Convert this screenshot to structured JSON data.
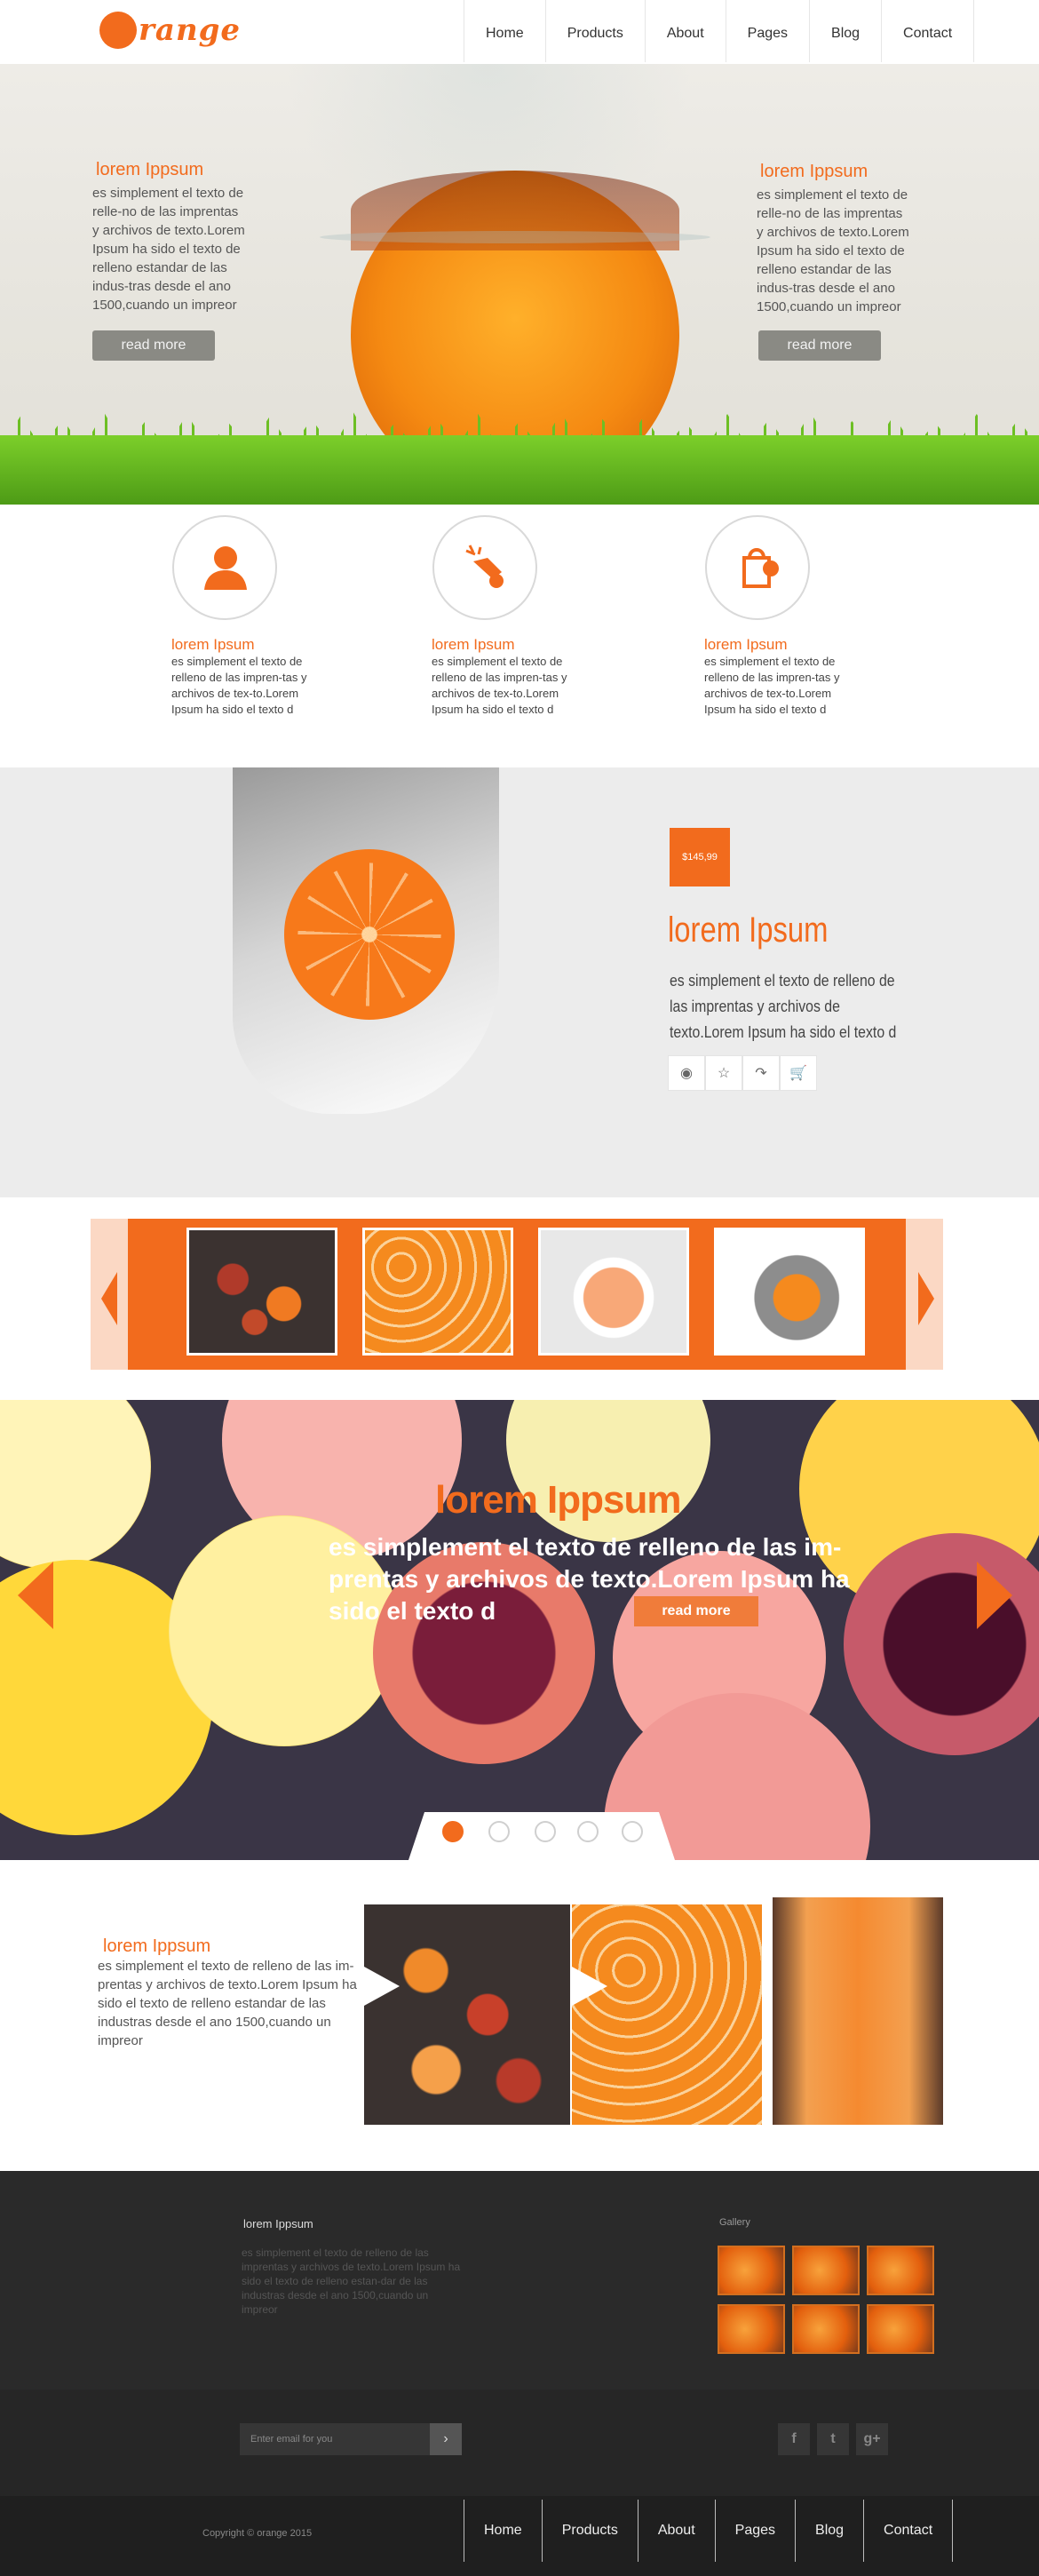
{
  "header": {
    "logo_text": "range",
    "nav": [
      "Home",
      "Products",
      "About",
      "Pages",
      "Blog",
      "Contact"
    ]
  },
  "hero": {
    "left": {
      "title": "lorem Ippsum",
      "text": "es simplement el texto de relle-no de las imprentas y archivos de texto.Lorem Ipsum ha sido el texto de relleno estandar de las indus-tras desde el ano 1500,cuando un impreor",
      "button": "read more"
    },
    "right": {
      "title": "lorem Ippsum",
      "text": "es simplement el texto de relle-no de las imprentas y archivos de texto.Lorem Ipsum ha sido el texto de relleno estandar de las indus-tras desde el ano 1500,cuando un impreor",
      "button": "read more"
    }
  },
  "features": [
    {
      "icon": "person-icon",
      "title": "lorem Ipsum",
      "text": "es simplement el texto de relleno de las impren-tas y archivos de tex-to.Lorem Ipsum ha sido el texto d"
    },
    {
      "icon": "hand-gesture-icon",
      "title": "lorem Ipsum",
      "text": "es simplement el texto de relleno de las impren-tas y archivos de tex-to.Lorem Ipsum ha sido el texto d"
    },
    {
      "icon": "shopping-bag-icon",
      "title": "lorem Ipsum",
      "text": "es simplement el texto de relleno de las impren-tas y archivos de tex-to.Lorem Ipsum ha sido el texto d"
    }
  ],
  "product": {
    "price": "$145,99",
    "title": "lorem Ipsum",
    "text": "es simplement el texto de relleno de las imprentas y archivos de texto.Lorem Ipsum ha sido el texto d",
    "actions": [
      "eye-icon",
      "star-icon",
      "share-icon",
      "cart-icon"
    ]
  },
  "slider": {
    "title": "lorem Ippsum",
    "text": "es simplement el texto de relleno de las im-prentas y archivos de texto.Lorem Ipsum ha sido el texto d",
    "button": "read more",
    "dots_total": 5,
    "active_dot": 1
  },
  "gallery_row": {
    "title": "lorem Ippsum",
    "text": "es simplement el texto de relleno de las im-prentas y archivos de texto.Lorem Ipsum ha sido el texto de relleno estandar de las industras desde el ano 1500,cuando un impreor"
  },
  "footer": {
    "about_title": "lorem Ippsum",
    "about_text": "es simplement el texto de relleno de las imprentas y archivos de texto.Lorem Ipsum ha sido el texto de relleno estan-dar de las industras desde el ano 1500,cuando un impreor",
    "gallery_title": "Gallery",
    "email_placeholder": "Enter email for you",
    "social": [
      "f",
      "t",
      "g+"
    ],
    "copyright": "Copyright © orange 2015",
    "nav": [
      "Home",
      "Products",
      "About",
      "Pages",
      "Blog",
      "Contact"
    ]
  },
  "colors": {
    "accent": "#f26b1d",
    "footer": "#2a2a2a"
  }
}
